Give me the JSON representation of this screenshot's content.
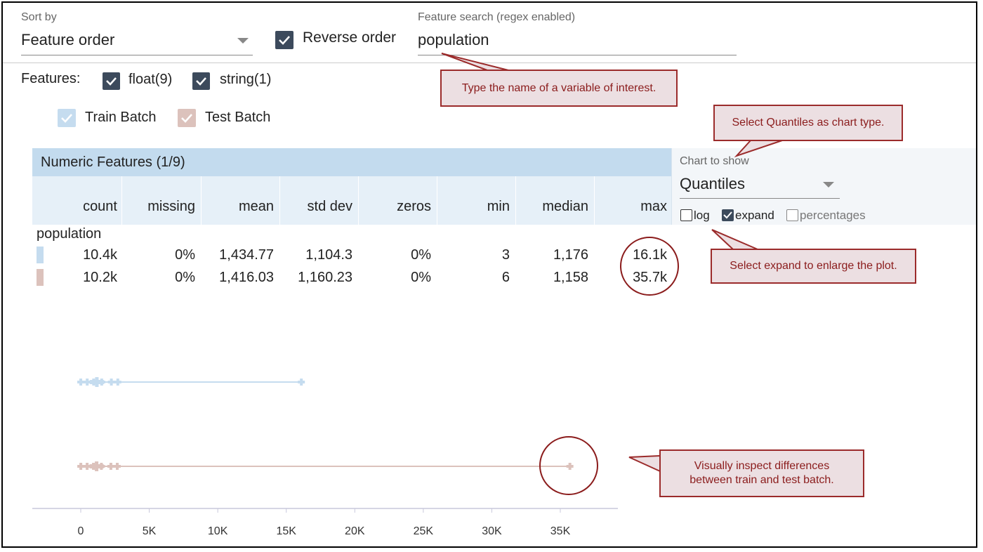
{
  "sort": {
    "label": "Sort by",
    "value": "Feature order"
  },
  "reverse": {
    "label": "Reverse order",
    "checked": true
  },
  "search": {
    "label": "Feature search (regex enabled)",
    "value": "population"
  },
  "features": {
    "label": "Features:",
    "filters": [
      {
        "label": "float(9)",
        "checked": true
      },
      {
        "label": "string(1)",
        "checked": true
      }
    ]
  },
  "batches": [
    {
      "label": "Train Batch",
      "color": "#c5dcef"
    },
    {
      "label": "Test Batch",
      "color": "#dcc2bc"
    }
  ],
  "table": {
    "title": "Numeric Features (1/9)",
    "columns": [
      "count",
      "missing",
      "mean",
      "std dev",
      "zeros",
      "min",
      "median",
      "max"
    ],
    "feature_name": "population",
    "rows": [
      {
        "batch": "train",
        "values": [
          "10.4k",
          "0%",
          "1,434.77",
          "1,104.3",
          "0%",
          "3",
          "1,176",
          "16.1k"
        ]
      },
      {
        "batch": "test",
        "values": [
          "10.2k",
          "0%",
          "1,416.03",
          "1,160.23",
          "0%",
          "6",
          "1,158",
          "35.7k"
        ]
      }
    ]
  },
  "chart_control": {
    "label": "Chart to show",
    "value": "Quantiles",
    "options": [
      {
        "label": "log",
        "checked": false
      },
      {
        "label": "expand",
        "checked": true
      },
      {
        "label": "percentages",
        "checked": false
      }
    ]
  },
  "callouts": {
    "search": "Type the name of a variable of interest.",
    "chart_type": "Select Quantiles as chart type.",
    "expand": "Select expand to enlarge the plot.",
    "inspect": "Visually inspect differences between train and test batch."
  },
  "chart_data": {
    "type": "box",
    "x_ticks": [
      "0",
      "5K",
      "10K",
      "15K",
      "20K",
      "25K",
      "30K",
      "35K"
    ],
    "xlim": [
      0,
      38000
    ],
    "series": [
      {
        "name": "Train Batch",
        "min": 3,
        "median": 1176,
        "max": 16100,
        "color": "#c5dcef"
      },
      {
        "name": "Test Batch",
        "min": 6,
        "median": 1158,
        "max": 35700,
        "color": "#dcc2bc"
      }
    ]
  }
}
